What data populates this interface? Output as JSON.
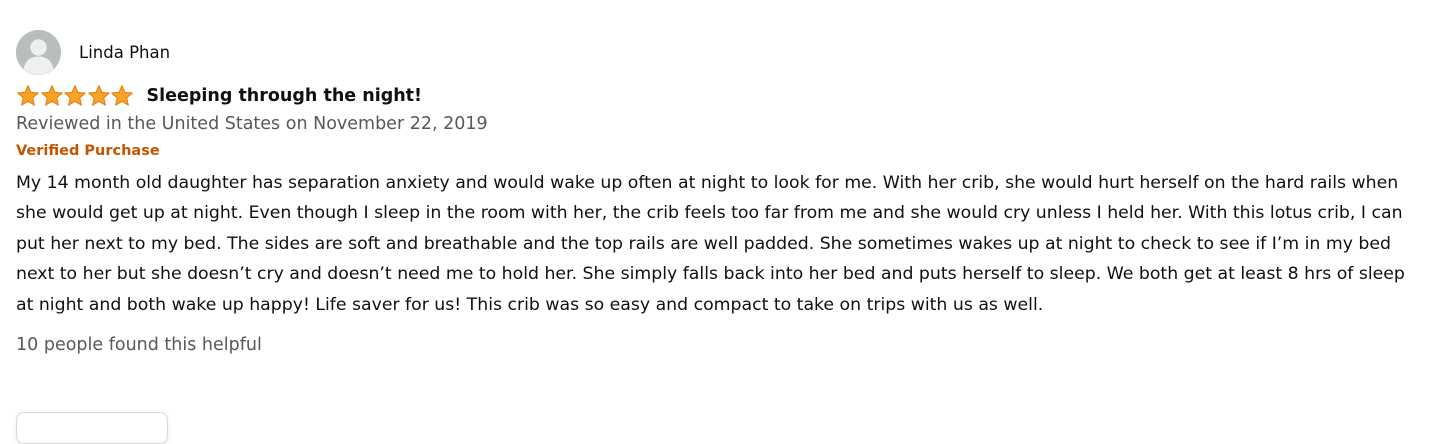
{
  "review": {
    "profile_name": "Linda Phan",
    "rating": 5,
    "rating_max": 5,
    "title": "Sleeping through the night!",
    "date_line": "Reviewed in the United States on November 22, 2019",
    "badge": "Verified Purchase",
    "body": "My 14 month old daughter has separation anxiety and would wake up often at night to look for me. With her crib, she would hurt herself on the hard rails when she would get up at night. Even though I sleep in the room with her, the crib feels too far from me and she would cry unless I held her. With this lotus crib, I can put her next to my bed. The sides are soft and breathable and the top rails are well padded. She sometimes wakes up at night to check to see if I’m in my bed next to her but she doesn’t cry and doesn’t need me to hold her. She simply falls back into her bed and puts herself to sleep. We both get at least 8 hrs of sleep at night and both wake up happy! Life saver for us! This crib was so easy and compact to take on trips with us as well.",
    "helpful_text": "10 people found this helpful"
  },
  "icons": {
    "avatar": "default-avatar-icon",
    "star": "star-icon"
  },
  "colors": {
    "star_fill": "#f7a325",
    "star_stroke": "#e47911",
    "badge": "#c45500",
    "secondary_text": "#565959",
    "avatar_bg": "#b9bdbd"
  }
}
